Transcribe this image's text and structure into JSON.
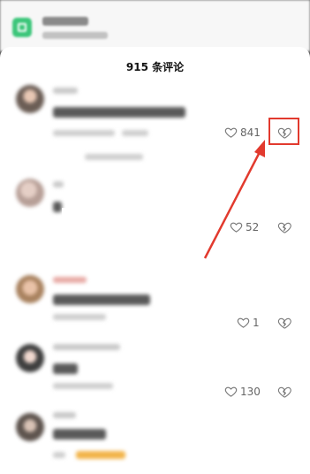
{
  "header": {
    "title": "915 条评论"
  },
  "comments": [
    {
      "likes": "841"
    },
    {
      "likes": "52"
    },
    {
      "likes": "1"
    },
    {
      "likes": "130"
    }
  ],
  "colors": {
    "highlight": "#e23a2e",
    "text": "#111111",
    "icon": "#777777"
  }
}
